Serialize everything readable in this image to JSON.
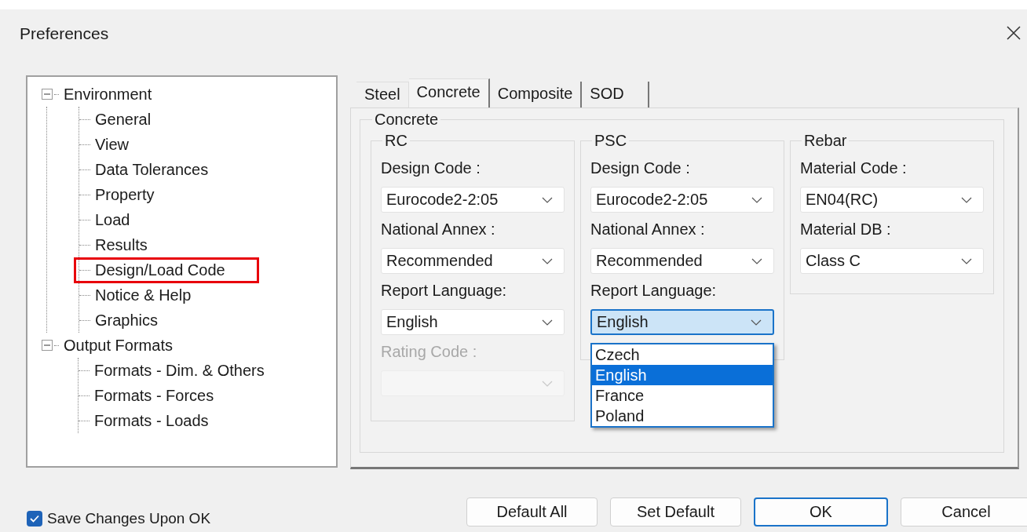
{
  "window": {
    "title": "Preferences"
  },
  "tree": [
    {
      "label": "Environment",
      "expanded": true,
      "children": [
        {
          "label": "General",
          "highlighted": false
        },
        {
          "label": "View",
          "highlighted": false
        },
        {
          "label": "Data Tolerances",
          "highlighted": false
        },
        {
          "label": "Property",
          "highlighted": false
        },
        {
          "label": "Load",
          "highlighted": false
        },
        {
          "label": "Results",
          "highlighted": false
        },
        {
          "label": "Design/Load Code",
          "highlighted": true
        },
        {
          "label": "Notice & Help",
          "highlighted": false
        },
        {
          "label": "Graphics",
          "highlighted": false
        }
      ]
    },
    {
      "label": "Output Formats",
      "expanded": true,
      "children": [
        {
          "label": "Formats - Dim. & Others",
          "highlighted": false
        },
        {
          "label": "Formats - Forces",
          "highlighted": false
        },
        {
          "label": "Formats - Loads",
          "highlighted": false
        }
      ]
    }
  ],
  "tabs": [
    {
      "label": "Steel",
      "selected": false
    },
    {
      "label": "Concrete",
      "selected": true
    },
    {
      "label": "Composite",
      "selected": false
    },
    {
      "label": "SOD",
      "selected": false
    }
  ],
  "group": {
    "title": "Concrete",
    "sections": [
      {
        "title": "RC",
        "fields": [
          {
            "label": "Design Code :",
            "value": "Eurocode2-2:05",
            "disabled": false,
            "focused": false
          },
          {
            "label": "National Annex :",
            "value": "Recommended",
            "disabled": false,
            "focused": false
          },
          {
            "label": "Report Language:",
            "value": "English",
            "disabled": false,
            "focused": false
          },
          {
            "label": "Rating Code :",
            "disabled": true,
            "focused": false
          }
        ]
      },
      {
        "title": "PSC",
        "fields": [
          {
            "label": "Design Code :",
            "value": "Eurocode2-2:05",
            "disabled": false,
            "focused": false
          },
          {
            "label": "National Annex :",
            "value": "Recommended",
            "disabled": false,
            "focused": false
          },
          {
            "label": "Report Language:",
            "value": "English",
            "disabled": false,
            "focused": true,
            "options": [
              {
                "label": "Czech",
                "selected": false
              },
              {
                "label": "English",
                "selected": true
              },
              {
                "label": "France",
                "selected": false
              },
              {
                "label": "Poland",
                "selected": false
              }
            ]
          }
        ]
      },
      {
        "title": "Rebar",
        "fields": [
          {
            "label": "Material Code :",
            "value": "EN04(RC)",
            "disabled": false,
            "focused": false
          },
          {
            "label": "Material DB :",
            "value": "Class C",
            "disabled": false,
            "focused": false
          }
        ]
      }
    ]
  },
  "save_changes": {
    "label": "Save Changes Upon OK",
    "checked": true
  },
  "buttons": [
    {
      "label": "Default All",
      "focused": false
    },
    {
      "label": "Set Default",
      "focused": false
    },
    {
      "label": "OK",
      "focused": true
    },
    {
      "label": "Cancel",
      "focused": false
    }
  ]
}
